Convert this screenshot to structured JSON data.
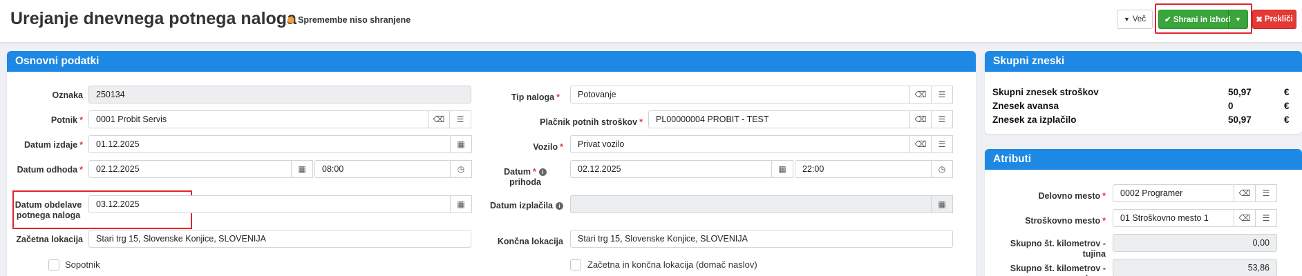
{
  "header": {
    "title": "Urejanje dnevnega potnega naloga",
    "unsaved": "Spremembe niso shranjene",
    "btn_more": "Več",
    "btn_save": "Shrani in izhod",
    "btn_cancel": "Prekliči"
  },
  "basic": {
    "title": "Osnovni podatki",
    "oznaka_label": "Oznaka",
    "oznaka_value": "250134",
    "potnik_label": "Potnik",
    "potnik_value": "0001 Probit Servis",
    "izdaje_label": "Datum izdaje",
    "izdaje_value": "01.12.2025",
    "odhoda_label": "Datum odhoda",
    "odhoda_date": "02.12.2025",
    "odhoda_time": "08:00",
    "obdelave_label_1": "Datum obdelave",
    "obdelave_label_2": "potnega naloga",
    "obdelave_value": "03.12.2025",
    "zacetna_label": "Začetna lokacija",
    "zacetna_value": "Stari trg 15, Slovenske Konjice, SLOVENIJA",
    "sopotnik_label": "Sopotnik",
    "tip_label": "Tip naloga",
    "tip_value": "Potovanje",
    "placnik_label": "Plačnik potnih stroškov",
    "placnik_value": "PL00000004 PROBIT - TEST",
    "vozilo_label": "Vozilo",
    "vozilo_value": "Privat vozilo",
    "prihoda_label_1": "Datum",
    "prihoda_label_2": "prihoda",
    "prihoda_date": "02.12.2025",
    "prihoda_time": "22:00",
    "izplacila_label": "Datum izplačila",
    "izplacila_value": "",
    "koncna_label": "Končna lokacija",
    "koncna_value": "Stari trg 15, Slovenske Konjice, SLOVENIJA",
    "domac_label": "Začetna in končna lokacija (domač naslov)"
  },
  "totals": {
    "title": "Skupni zneski",
    "rows": [
      {
        "label": "Skupni znesek stroškov",
        "value": "50,97",
        "cur": "€"
      },
      {
        "label": "Znesek avansa",
        "value": "0",
        "cur": "€"
      },
      {
        "label": "Znesek za izplačilo",
        "value": "50,97",
        "cur": "€"
      }
    ]
  },
  "attrs": {
    "title": "Atributi",
    "delovno_label": "Delovno mesto",
    "delovno_value": "0002 Programer",
    "strosek_label": "Stroškovno mesto",
    "strosek_value": "01 Stroškovno mesto 1",
    "tujina_label": "Skupno št. kilometrov - tujina",
    "tujina_value": "0,00",
    "doma_label": "Skupno št. kilometrov - doma",
    "doma_value": "53,86"
  },
  "icons": {
    "check": "check-icon",
    "caret": "caret-down-icon",
    "times": "times-icon",
    "eraser": "eraser-icon",
    "list": "list-icon",
    "calendar": "calendar-icon",
    "clock": "clock-icon",
    "info": "info-icon"
  },
  "colors": {
    "accent": "#1e88e5",
    "save": "#3aa53a",
    "cancel": "#e53935",
    "unsaved_dot": "#f0a03c",
    "highlight": "#e0242b"
  }
}
